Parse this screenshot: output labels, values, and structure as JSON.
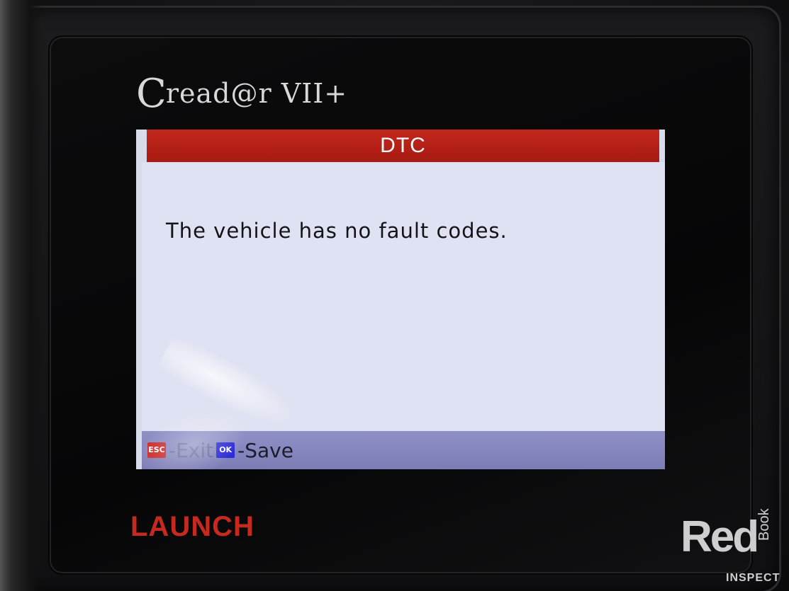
{
  "device": {
    "logo_prefix": "C",
    "logo_rest": "read@r",
    "logo_model": "VII+",
    "maker": "LAUNCH"
  },
  "screen": {
    "title": "DTC",
    "message": "The vehicle has no fault codes.",
    "footer": {
      "esc_chip": "ESC",
      "exit_label": "-Exit",
      "ok_chip": "OK",
      "save_label": "-Save"
    }
  },
  "watermark": {
    "red": "Red",
    "book": "Book",
    "inspect": "INSPECT"
  },
  "colors": {
    "title_bar": "#b32018",
    "screen_bg": "#dfe2f2",
    "footer_bg": "#8586bd",
    "esc_chip": "#cc2a2a",
    "ok_chip": "#2a2ad8",
    "launch_red": "#c62a1e"
  }
}
